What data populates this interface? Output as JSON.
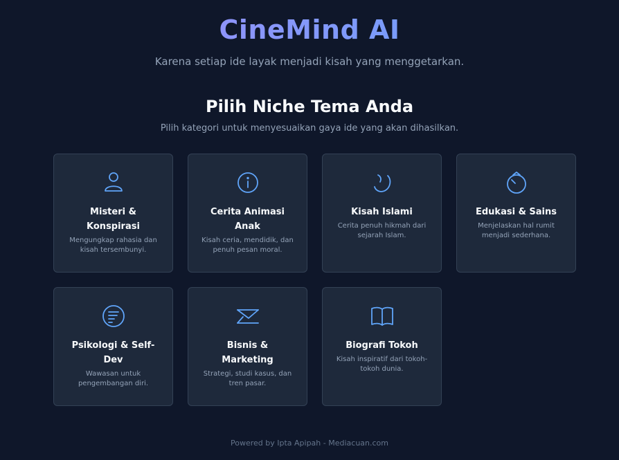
{
  "header": {
    "title": "CineMind AI",
    "tagline": "Karena setiap ide layak menjadi kisah yang menggetarkan."
  },
  "section": {
    "title": "Pilih Niche Tema Anda",
    "subtitle": "Pilih kategori untuk menyesuaikan gaya ide yang akan dihasilkan."
  },
  "cards": [
    {
      "icon": "user-icon",
      "title": "Misteri & Konspirasi",
      "desc": "Mengungkap rahasia dan kisah tersembunyi."
    },
    {
      "icon": "info-icon",
      "title": "Cerita Animasi Anak",
      "desc": "Kisah ceria, mendidik, dan penuh pesan moral."
    },
    {
      "icon": "crescent-icon",
      "title": "Kisah Islami",
      "desc": "Cerita penuh hikmah dari sejarah Islam."
    },
    {
      "icon": "flask-icon",
      "title": "Edukasi & Sains",
      "desc": "Menjelaskan hal rumit menjadi sederhana."
    },
    {
      "icon": "list-circle-icon",
      "title": "Psikologi & Self-Dev",
      "desc": "Wawasan untuk pengembangan diri."
    },
    {
      "icon": "chart-arrow-icon",
      "title": "Bisnis & Marketing",
      "desc": "Strategi, studi kasus, dan tren pasar."
    },
    {
      "icon": "book-icon",
      "title": "Biografi Tokoh",
      "desc": "Kisah inspiratif dari tokoh-tokoh dunia."
    }
  ],
  "footer": {
    "text": "Powered by Ipta Apipah - Mediacuan.com"
  },
  "colors": {
    "background": "#0f172a",
    "card": "#1e293b",
    "accent": "#60a5fa",
    "title_gradient_start": "#a78bfa",
    "title_gradient_end": "#60a5fa"
  }
}
